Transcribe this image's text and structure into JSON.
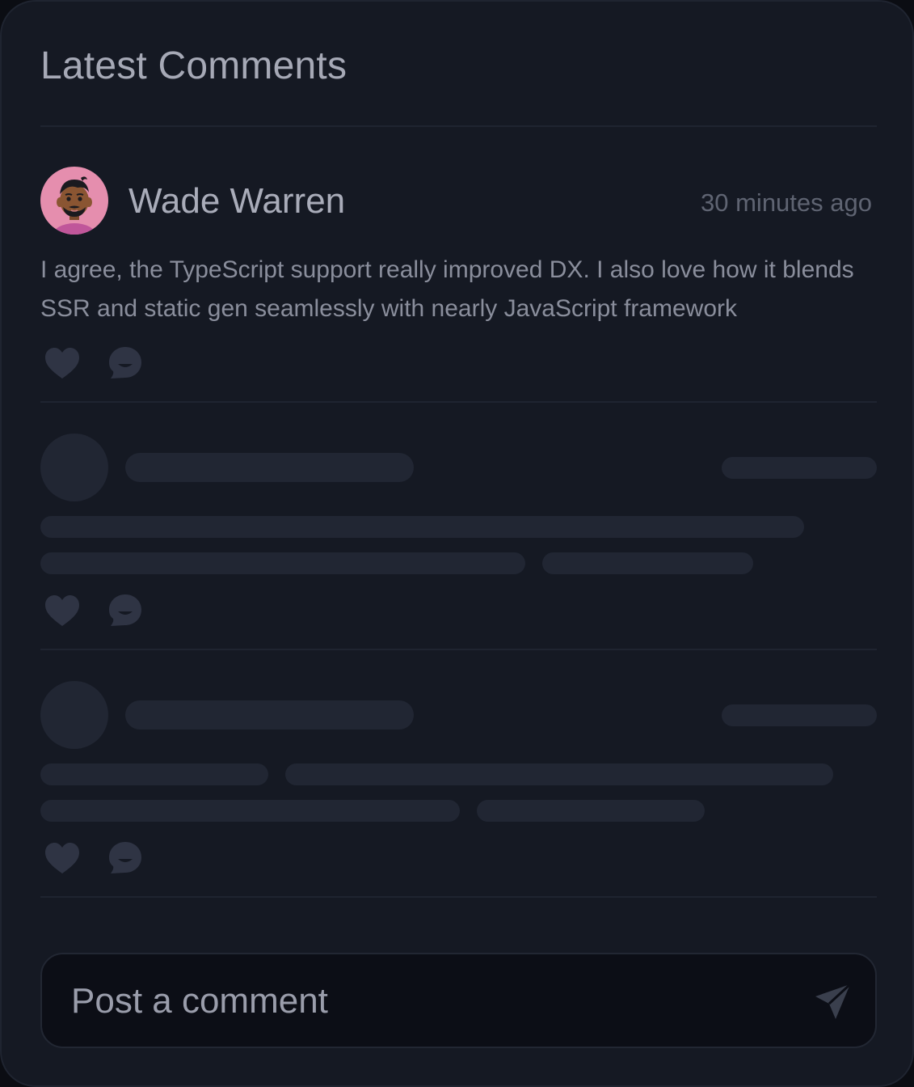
{
  "header": {
    "title": "Latest Comments"
  },
  "comments": [
    {
      "author": "Wade Warren",
      "time": "30 minutes ago",
      "text": "I agree, the TypeScript support really improved DX. I also love how it blends SSR and static gen seamlessly with nearly JavaScript framework",
      "like_icon": "heart-icon",
      "reply_icon": "chat-bubble-icon"
    }
  ],
  "composer": {
    "placeholder": "Post a comment",
    "send_icon": "send-icon"
  },
  "colors": {
    "card_bg": "#151923",
    "skeleton": "#212633",
    "icon": "#2f3444",
    "text_muted": "#8a8e9c",
    "avatar_bg": "#e58eae"
  }
}
